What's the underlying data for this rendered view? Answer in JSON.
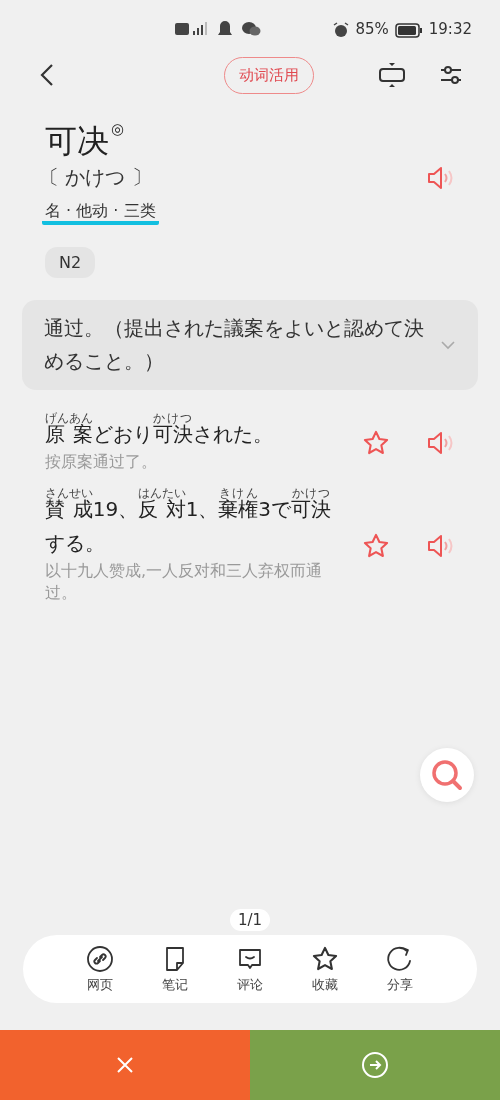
{
  "status_bar": {
    "battery": "85%",
    "time": "19:32"
  },
  "header": {
    "conjugation_button": "动词活用"
  },
  "entry": {
    "word": "可决",
    "mark": "◎",
    "reading": "〔 かけつ 〕",
    "part_of_speech": "名 · 他动 · 三类",
    "jlpt": "N2"
  },
  "definition": {
    "text": "通过。（提出された議案をよいと認めて決めること。）",
    "expanded": false
  },
  "examples": [
    {
      "segments": [
        {
          "text": "原 案",
          "ruby": "げんあん"
        },
        {
          "text": "どおり"
        },
        {
          "text": "可決",
          "ruby": "かけつ"
        },
        {
          "text": "された。"
        }
      ],
      "translation": "按原案通过了。",
      "starred": false
    },
    {
      "segments": [
        {
          "text": "賛 成",
          "ruby": "さんせい"
        },
        {
          "text": "19、"
        },
        {
          "text": "反 対",
          "ruby": "はんたい"
        },
        {
          "text": "1、"
        },
        {
          "text": "棄権",
          "ruby": "きけん"
        },
        {
          "text": "3で"
        },
        {
          "text": "可決",
          "ruby": "かけつ"
        },
        {
          "text": "する。"
        }
      ],
      "translation": "以十九人赞成,一人反对和三人弃权而通过。",
      "starred": false
    }
  ],
  "pager": "1/1",
  "toolbar": [
    {
      "label": "网页",
      "kind": "link"
    },
    {
      "label": "笔记",
      "kind": "note"
    },
    {
      "label": "评论",
      "kind": "comment"
    },
    {
      "label": "收藏",
      "kind": "star"
    },
    {
      "label": "分享",
      "kind": "share"
    }
  ]
}
